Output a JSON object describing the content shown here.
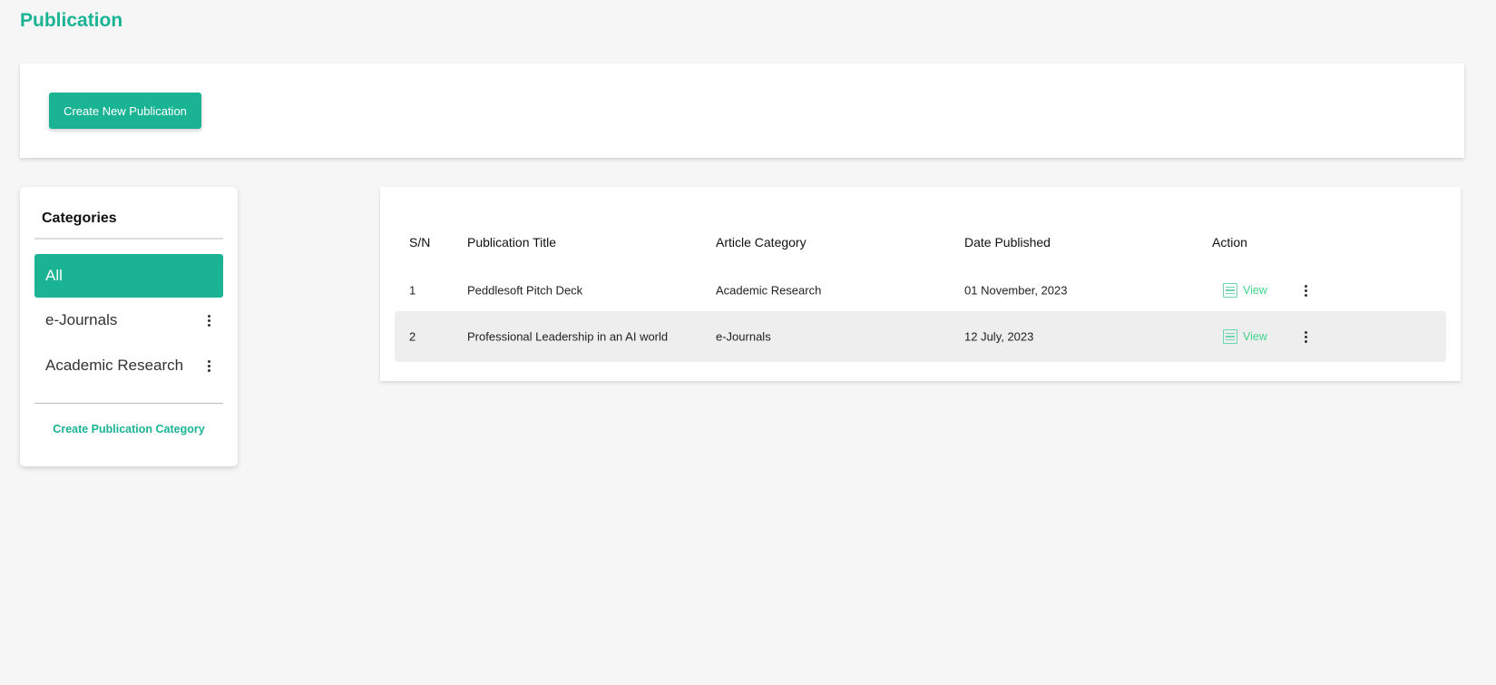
{
  "page": {
    "title": "Publication"
  },
  "toolbar": {
    "create_label": "Create New Publication"
  },
  "categories": {
    "title": "Categories",
    "items": [
      {
        "label": "All",
        "active": true
      },
      {
        "label": "e-Journals",
        "active": false
      },
      {
        "label": "Academic Research",
        "active": false
      }
    ],
    "create_label": "Create Publication Category"
  },
  "table": {
    "headers": [
      "S/N",
      "Publication Title",
      "Article Category",
      "Date Published",
      "Action"
    ],
    "rows": [
      {
        "sn": "1",
        "title": "Peddlesoft Pitch Deck",
        "category": "Academic Research",
        "date": "01 November, 2023",
        "action": "View"
      },
      {
        "sn": "2",
        "title": "Professional Leadership in an AI world",
        "category": "e-Journals",
        "date": "12 July, 2023",
        "action": "View"
      }
    ]
  },
  "colors": {
    "accent": "#1ab394",
    "view_link": "#3dd68c",
    "background": "#f6f6f6"
  },
  "icons": {
    "row_action": "document-icon",
    "menu": "kebab-menu-icon"
  }
}
